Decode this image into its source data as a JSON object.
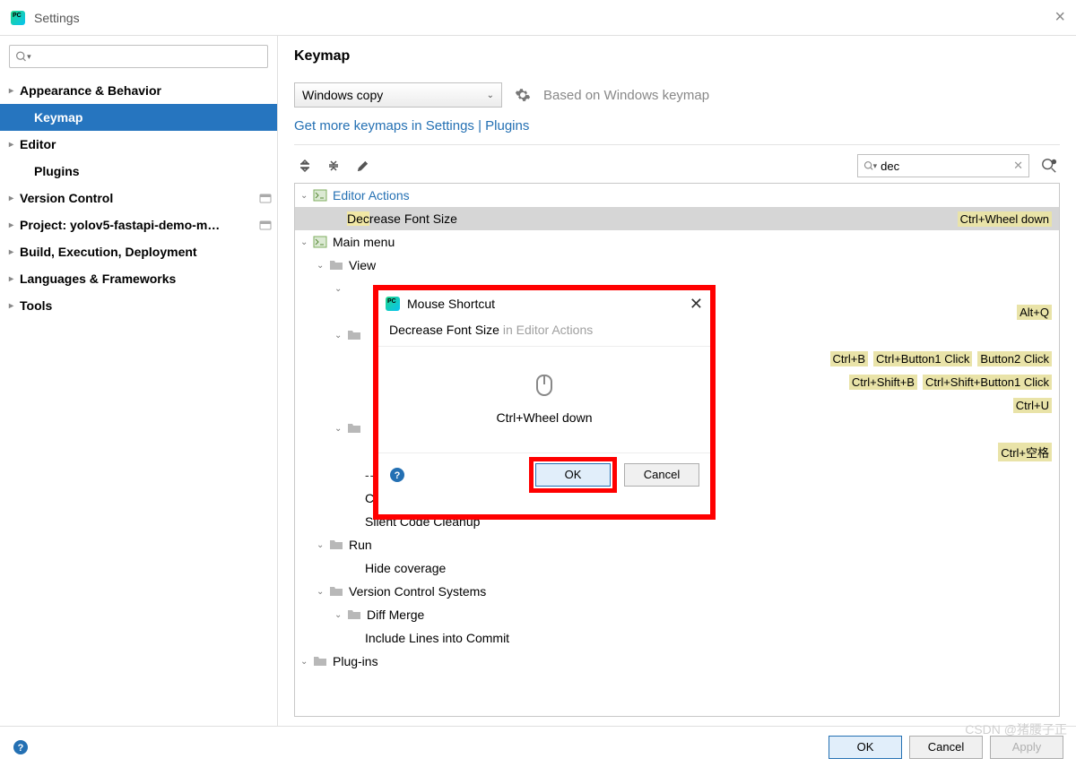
{
  "window": {
    "title": "Settings"
  },
  "sidebar": {
    "search_placeholder": "",
    "items": [
      {
        "label": "Appearance & Behavior",
        "bold": true,
        "arrow": true
      },
      {
        "label": "Keymap",
        "bold": true,
        "child": true,
        "selected": true
      },
      {
        "label": "Editor",
        "bold": true,
        "arrow": true
      },
      {
        "label": "Plugins",
        "bold": true,
        "child": true
      },
      {
        "label": "Version Control",
        "bold": true,
        "arrow": true,
        "badge": true
      },
      {
        "label": "Project: yolov5-fastapi-demo-m…",
        "bold": true,
        "arrow": true,
        "badge": true
      },
      {
        "label": "Build, Execution, Deployment",
        "bold": true,
        "arrow": true
      },
      {
        "label": "Languages & Frameworks",
        "bold": true,
        "arrow": true
      },
      {
        "label": "Tools",
        "bold": true,
        "arrow": true
      }
    ]
  },
  "content": {
    "heading": "Keymap",
    "keymap_selected": "Windows copy",
    "based_on": "Based on Windows keymap",
    "more_link": "Get more keymaps in Settings | Plugins",
    "action_search": "dec"
  },
  "tree": [
    {
      "indent": 0,
      "arrow": "down",
      "icon": "actions",
      "label": "Editor Actions",
      "link": true
    },
    {
      "indent": 2,
      "label_pre": "Dec",
      "label_rest": "rease Font Size",
      "highlighted": true,
      "shortcuts": [
        "Ctrl+Wheel down"
      ]
    },
    {
      "indent": 0,
      "arrow": "down",
      "icon": "actions",
      "label": "Main menu"
    },
    {
      "indent": 1,
      "arrow": "down",
      "icon": "folder",
      "label": "View"
    },
    {
      "indent": 2,
      "arrow": "down",
      "hidden_by_modal": true
    },
    {
      "indent": 3,
      "hidden_by_modal": true,
      "shortcuts": [
        "Alt+Q"
      ]
    },
    {
      "indent": 2,
      "arrow": "down",
      "icon": "folder",
      "hidden_by_modal": true
    },
    {
      "indent": 3,
      "hidden_by_modal": true,
      "shortcuts": [
        "Ctrl+B",
        "Ctrl+Button1 Click",
        "Button2 Click"
      ]
    },
    {
      "indent": 3,
      "hidden_by_modal": true,
      "shortcuts": [
        "Ctrl+Shift+B",
        "Ctrl+Shift+Button1 Click"
      ]
    },
    {
      "indent": 3,
      "hidden_by_modal": true,
      "shortcuts": [
        "Ctrl+U"
      ]
    },
    {
      "indent": 2,
      "arrow": "down",
      "icon": "folder",
      "hidden_by_modal": true
    },
    {
      "indent": 3,
      "hidden_by_modal": true,
      "shortcuts": [
        "Ctrl+空格"
      ]
    },
    {
      "indent": 3,
      "label": "------------",
      "dashes": true
    },
    {
      "indent": 3,
      "label": "Code Cleanup…"
    },
    {
      "indent": 3,
      "label": "Silent Code Cleanup"
    },
    {
      "indent": 1,
      "arrow": "down",
      "icon": "folder",
      "label": "Run"
    },
    {
      "indent": 3,
      "label": "Hide coverage"
    },
    {
      "indent": 1,
      "arrow": "down",
      "icon": "folder",
      "label": "Version Control Systems"
    },
    {
      "indent": 2,
      "arrow": "down",
      "icon": "folder",
      "label": "Diff  Merge"
    },
    {
      "indent": 3,
      "label": "Include Lines into Commit"
    },
    {
      "indent": 0,
      "arrow": "down",
      "icon": "folder",
      "label": "Plug-ins"
    }
  ],
  "modal": {
    "title": "Mouse Shortcut",
    "action": "Decrease Font Size",
    "context": "in Editor Actions",
    "shortcut": "Ctrl+Wheel down",
    "ok": "OK",
    "cancel": "Cancel"
  },
  "footer": {
    "ok": "OK",
    "cancel": "Cancel",
    "apply": "Apply"
  },
  "watermark": "CSDN @猪腰子正"
}
